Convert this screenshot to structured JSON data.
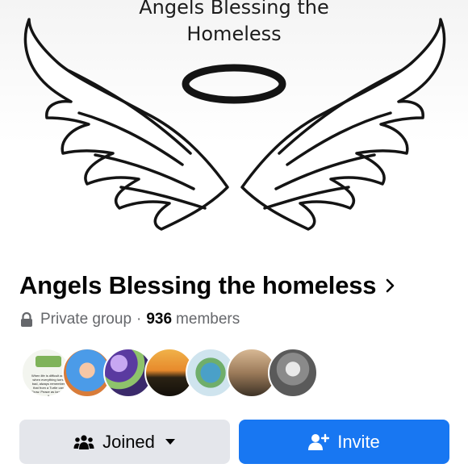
{
  "cover": {
    "line1": "Angels Blessing the",
    "line2": "Homeless"
  },
  "group": {
    "name": "Angels Blessing the homeless",
    "privacy": "Private group",
    "separator": "·",
    "member_count": "936",
    "members_label": "members"
  },
  "member_avatars": [
    {
      "icon": "member-avatar-quote-card",
      "caption": "When life is difficult and when everything turns bad, always remember that from a Turtle can Grow. Peace as long as it"
    },
    {
      "icon": "member-avatar-blue-hair"
    },
    {
      "icon": "member-avatar-purple-flowers"
    },
    {
      "icon": "member-avatar-sunset-palm"
    },
    {
      "icon": "member-avatar-globe"
    },
    {
      "icon": "member-avatar-people"
    },
    {
      "icon": "member-avatar-person-glasses"
    }
  ],
  "actions": {
    "joined_label": "Joined",
    "invite_label": "Invite"
  },
  "colors": {
    "primary_blue": "#1877f2",
    "secondary_gray": "#e4e6eb",
    "text_primary": "#050505",
    "text_secondary": "#65676b"
  },
  "icons": {
    "lock": "lock-icon",
    "chevron": "chevron-right-icon",
    "joined": "group-people-icon",
    "caret": "caret-down-icon",
    "invite": "add-person-icon"
  }
}
